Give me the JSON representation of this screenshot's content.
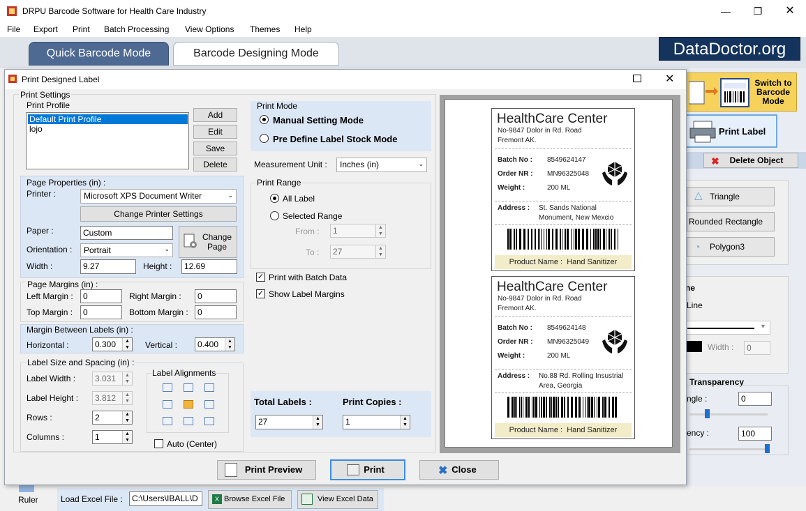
{
  "app": {
    "title": "DRPU Barcode Software for Health Care Industry",
    "brand": "DataDoctor.org"
  },
  "menu": [
    "File",
    "Export",
    "Print",
    "Batch Processing",
    "View Options",
    "Themes",
    "Help"
  ],
  "modes": {
    "quick": "Quick Barcode Mode",
    "designing": "Barcode Designing Mode"
  },
  "right_panel": {
    "switch_label": "Switch to Barcode Mode",
    "print_label": "Print Label",
    "delete_object": "Delete Object",
    "triangle": "Triangle",
    "rounded_rectangle": "Rounded Rectangle",
    "polygon3": "Polygon3",
    "partial_ne": "ne",
    "line": "Line",
    "width_label": "Width :",
    "width_value": "0",
    "transparency": "Transparency",
    "angle": "ngle :",
    "angle_value": "0",
    "opacity": "ency :",
    "opacity_value": "100",
    "slider1": 0.2,
    "slider2": 1.0
  },
  "bottom": {
    "ruler": "Ruler",
    "load_excel": "Load Excel File :",
    "excel_path": "C:\\Users\\IBALL\\D",
    "browse": "Browse Excel File",
    "view": "View Excel Data"
  },
  "dialog": {
    "title": "Print Designed Label",
    "print_settings": "Print Settings",
    "print_profile": "Print Profile",
    "profiles": [
      "Default Print Profile",
      "lojo"
    ],
    "profile_buttons": {
      "add": "Add",
      "edit": "Edit",
      "save": "Save",
      "delete": "Delete"
    },
    "page_properties": "Page Properties (in) :",
    "printer_label": "Printer :",
    "printer_value": "Microsoft XPS Document Writer",
    "change_printer": "Change Printer Settings",
    "paper_label": "Paper :",
    "paper_value": "Custom",
    "change_page": "Change Page",
    "orientation_label": "Orientation :",
    "orientation_value": "Portrait",
    "width_label": "Width :",
    "width_value": "9.27",
    "height_label": "Height :",
    "height_value": "12.69",
    "page_margins": "Page Margins (in) :",
    "left_margin": "Left Margin :",
    "left_value": "0",
    "right_margin": "Right Margin :",
    "right_value": "0",
    "top_margin": "Top Margin :",
    "top_value": "0",
    "bottom_margin": "Bottom Margin :",
    "bottom_value": "0",
    "margin_between": "Margin Between Labels (in) :",
    "horizontal_label": "Horizontal :",
    "horizontal_value": "0.300",
    "vertical_label": "Vertical :",
    "vertical_value": "0.400",
    "label_size": "Label Size and Spacing (in) :",
    "label_width": "Label Width :",
    "label_width_value": "3.031",
    "label_height": "Label Height :",
    "label_height_value": "3.812",
    "rows": "Rows :",
    "rows_value": "2",
    "columns": "Columns :",
    "columns_value": "1",
    "label_alignments": "Label Alignments",
    "auto_center": "Auto (Center)",
    "print_mode": "Print Mode",
    "manual_mode": "Manual Setting Mode",
    "predefine_mode": "Pre Define Label Stock Mode",
    "measurement_label": "Measurement Unit :",
    "measurement_value": "Inches (in)",
    "print_range": "Print Range",
    "all_label": "All Label",
    "selected_range": "Selected Range",
    "from_label": "From :",
    "from_value": "1",
    "to_label": "To :",
    "to_value": "27",
    "print_batch": "Print with Batch Data",
    "show_margins": "Show Label Margins",
    "total_labels": "Total Labels :",
    "total_value": "27",
    "print_copies": "Print Copies :",
    "copies_value": "1",
    "print_preview": "Print Preview",
    "print": "Print",
    "close": "Close"
  },
  "labels": [
    {
      "title": "HealthCare Center",
      "addr1": "No-9847 Dolor in Rd. Road",
      "addr2": "Fremont AK.",
      "batch_k": "Batch No :",
      "batch_v": "8549624147",
      "order_k": "Order NR :",
      "order_v": "MN96325048",
      "weight_k": "Weight :",
      "weight_v": "200 ML",
      "address_k": "Address :",
      "address_v1": "St. Sands National",
      "address_v2": "Monument, New Mexcio",
      "product_k": "Product Name :",
      "product_v": "Hand Sanitizer"
    },
    {
      "title": "HealthCare Center",
      "addr1": "No-9847 Dolor in Rd. Road",
      "addr2": "Fremont AK.",
      "batch_k": "Batch No :",
      "batch_v": "8549624148",
      "order_k": "Order NR :",
      "order_v": "MN96325049",
      "weight_k": "Weight :",
      "weight_v": "200 ML",
      "address_k": "Address :",
      "address_v1": "No.88 Rd. Rolling Insustrial",
      "address_v2": "Area, Georgia",
      "product_k": "Product Name :",
      "product_v": "Hand Sanitizer"
    }
  ]
}
